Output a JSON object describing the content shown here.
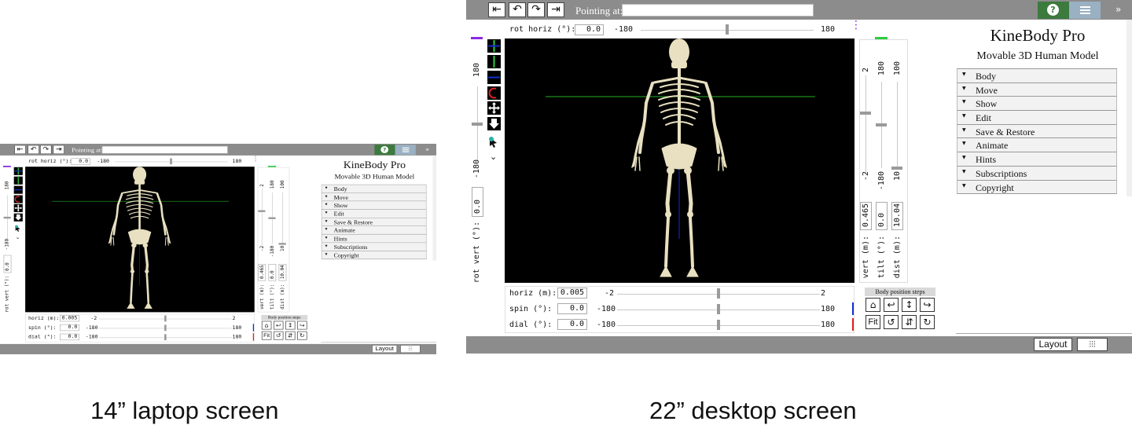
{
  "app": {
    "title": "KineBody Pro",
    "subtitle": "Movable 3D Human Model",
    "pointing_label": "Pointing at:",
    "pointing_value": "",
    "menu_items": [
      "Body",
      "Move",
      "Show",
      "Edit",
      "Save & Restore",
      "Animate",
      "Hints",
      "Subscriptions",
      "Copyright"
    ],
    "toolbar_icons": [
      "undo-all-icon",
      "undo-icon",
      "redo-icon",
      "redo-all-icon"
    ],
    "rot_horiz": {
      "label": "rot horiz (°):",
      "value": "0.0",
      "min": "-180",
      "max": "180",
      "level": 0.5
    },
    "rot_vert": {
      "label": "rot vert (°):",
      "value": "0.0",
      "min": "-180",
      "max": "180",
      "level": 0.5
    },
    "vert": {
      "label": "vert (m):",
      "value": "0.465",
      "min": "-2",
      "max": "2",
      "level": 0.62
    },
    "tilt": {
      "label": "tilt (°):",
      "value": "0.0",
      "min": "-180",
      "max": "180",
      "level": 0.5
    },
    "dist": {
      "label": "dist (m):",
      "value": "10.04",
      "min": "10",
      "max": "100",
      "level": 0.0
    },
    "horiz": {
      "label": "horiz (m):",
      "value": "0.005",
      "min": "-2",
      "max": "2",
      "level": 0.5
    },
    "spin": {
      "label": "spin  (°):",
      "value": "0.0",
      "min": "-180",
      "max": "180",
      "level": 0.5
    },
    "dial": {
      "label": "dial  (°):",
      "value": "0.0",
      "min": "-180",
      "max": "180",
      "level": 0.5
    },
    "body_position_steps": "Body position steps",
    "fit_label": "Fit",
    "layout_label": "Layout"
  },
  "colors": {
    "bar": "#8c8c8c",
    "help": "#3c7a3e",
    "menu": "#9ab0c3",
    "viewport": "#000000",
    "bone": "#e8e0c0",
    "horizon": "#1d8c1d",
    "purple_marker": "#8a2be2",
    "green_marker": "#2ecc40",
    "blue_marker": "#1030d0",
    "red_marker": "#e02020"
  },
  "captions": {
    "laptop": "14” laptop screen",
    "desktop": "22” desktop screen"
  }
}
